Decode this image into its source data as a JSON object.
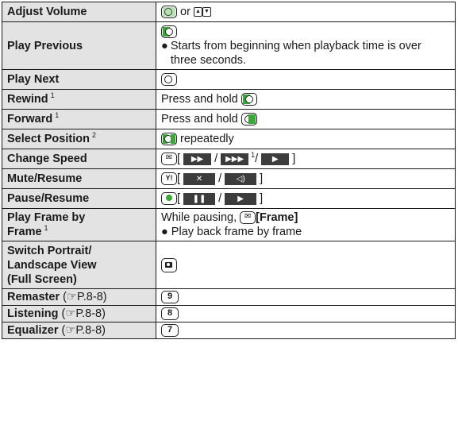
{
  "rows": [
    {
      "label": "Adjust Volume",
      "value_parts": [
        "or"
      ]
    },
    {
      "label": "Play Previous",
      "bullet": "Starts from beginning when playback time is over three seconds."
    },
    {
      "label": "Play Next"
    },
    {
      "label": "Rewind",
      "note": "1",
      "value_text": "Press and hold"
    },
    {
      "label": "Forward",
      "note": "1",
      "value_text": "Press and hold"
    },
    {
      "label": "Select Position",
      "note": "2",
      "value_text": "repeatedly"
    },
    {
      "label": "Change Speed",
      "note": "1"
    },
    {
      "label": "Mute/Resume"
    },
    {
      "label": "Pause/Resume"
    },
    {
      "label_lines": [
        "Play Frame by",
        "Frame"
      ],
      "note": "1",
      "value_text": "While pausing,",
      "value_bold": "[Frame]",
      "bullet": "Play back frame by frame"
    },
    {
      "label_lines": [
        "Switch Portrait/",
        "Landscape View",
        "(Full Screen)"
      ]
    },
    {
      "label": "Remaster",
      "ref": "P.8-8",
      "value_key": "9"
    },
    {
      "label": "Listening",
      "ref": "P.8-8",
      "value_key": "8"
    },
    {
      "label": "Equalizer",
      "ref": "P.8-8",
      "value_key": "7"
    }
  ],
  "icons": {
    "up_key": "▲",
    "down_key": "▼",
    "ff_glyph": "▶▶",
    "fff_glyph": "▶▶▶",
    "play_glyph": "▶",
    "mute_glyph": "✕",
    "speaker_glyph": "◁)",
    "pause_glyph": "❚❚",
    "y_glyph": "Y!",
    "ref_glyph": "☞",
    "bullet_glyph": "●"
  },
  "colors": {
    "label_bg": "#e3e3e3",
    "accent_green": "#3aa838",
    "soft_button": "#3c3c3c"
  }
}
